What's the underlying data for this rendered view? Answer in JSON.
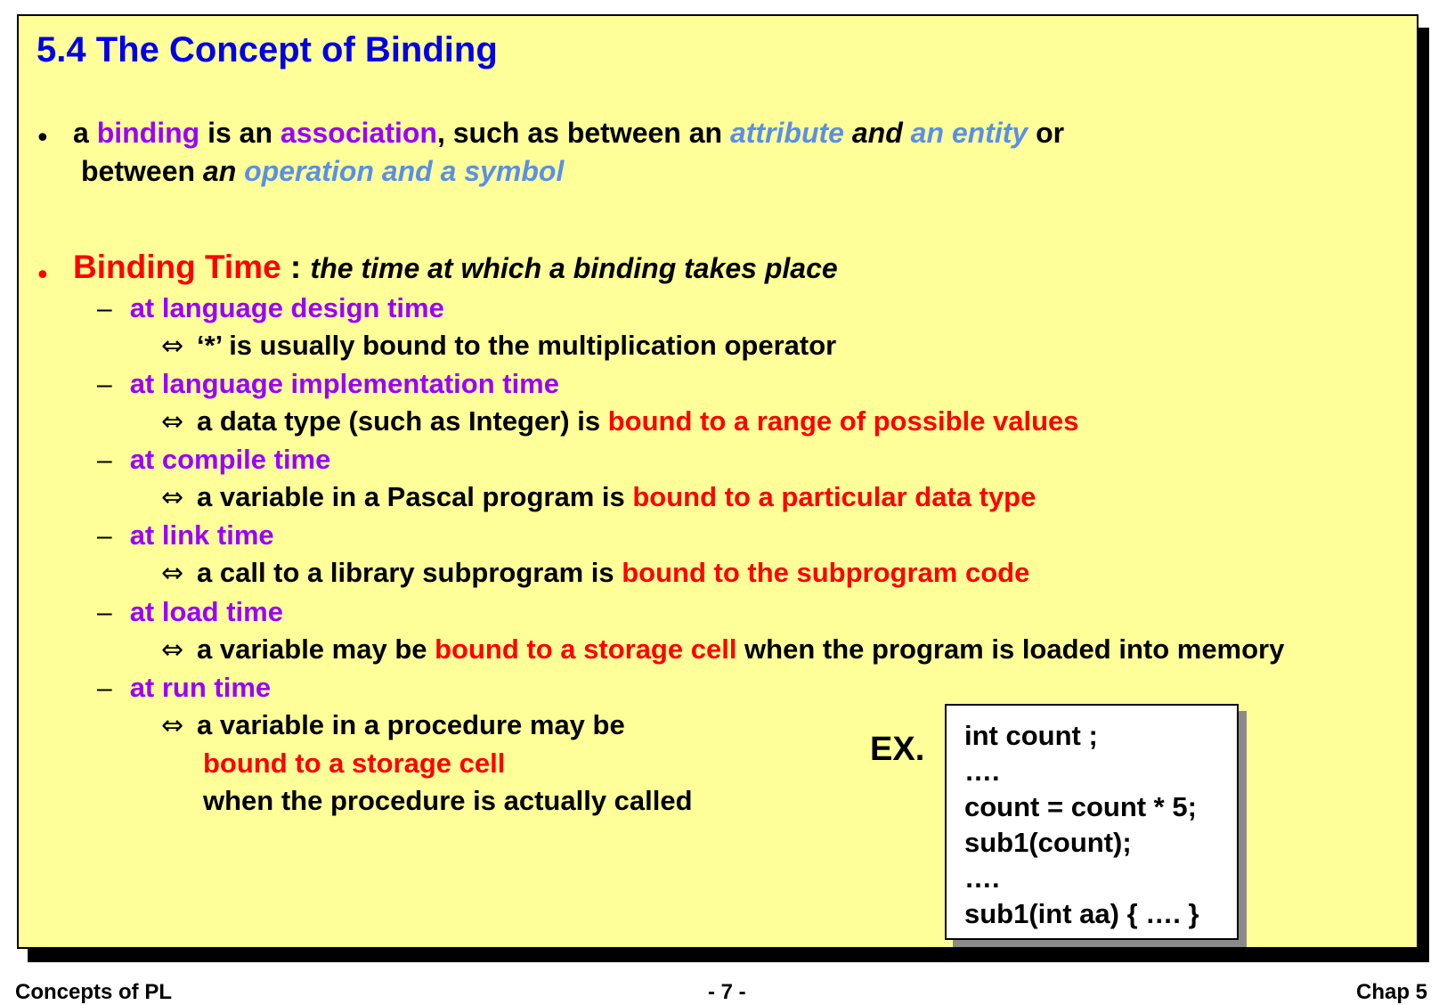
{
  "slide": {
    "title": "5.4 The Concept of Binding",
    "bullet1": {
      "marker": "•",
      "seg1": "a ",
      "seg2": "binding",
      "seg3": " is an ",
      "seg4": "association",
      "seg5": ", such as between an ",
      "seg6": "attribute",
      "seg7": " and ",
      "seg8": "an entity",
      "seg9": " or",
      "line2_seg1": "between ",
      "line2_seg2": "an ",
      "line2_seg3": "operation and a symbol"
    },
    "bullet2": {
      "marker": "•",
      "term": "Binding Time",
      "colon": " : ",
      "definition": "the time at which a binding takes place"
    },
    "dash_marker": "–",
    "arrow_glyph": "⇔",
    "items": [
      {
        "heading": "at language design time",
        "example": {
          "a": "‘*’ is usually bound to the multiplication operator"
        }
      },
      {
        "heading": "at language implementation time",
        "example": {
          "a": "a data type (such as Integer) is ",
          "b": "bound to a range of possible values"
        }
      },
      {
        "heading": "at compile time",
        "example": {
          "a": "a variable in a Pascal program is ",
          "b": "bound to a particular data type"
        }
      },
      {
        "heading": "at link time",
        "example": {
          "a": "a call to a library subprogram is ",
          "b": "bound to the subprogram code"
        }
      },
      {
        "heading": "at load time",
        "example": {
          "a": "a variable may be ",
          "b": "bound to a storage cell",
          "c": " when the program is loaded into memory"
        }
      },
      {
        "heading": "at run time",
        "example": {
          "a": "a variable in a procedure may be",
          "b": "bound to a storage cell",
          "c": "when the procedure is actually called"
        }
      }
    ],
    "ex_label": "EX.",
    "code_lines": [
      "int count ;",
      "….",
      "count = count * 5;",
      "sub1(count);",
      "….",
      "sub1(int aa) { …. }"
    ]
  },
  "footer": {
    "left": "Concepts of PL",
    "center": "- 7 -",
    "right": "Chap 5"
  },
  "colors": {
    "background": "#ffff99",
    "title": "#0000e6",
    "purple": "#9900ff",
    "light_blue": "#5b8fe6",
    "red": "#ff0000"
  }
}
